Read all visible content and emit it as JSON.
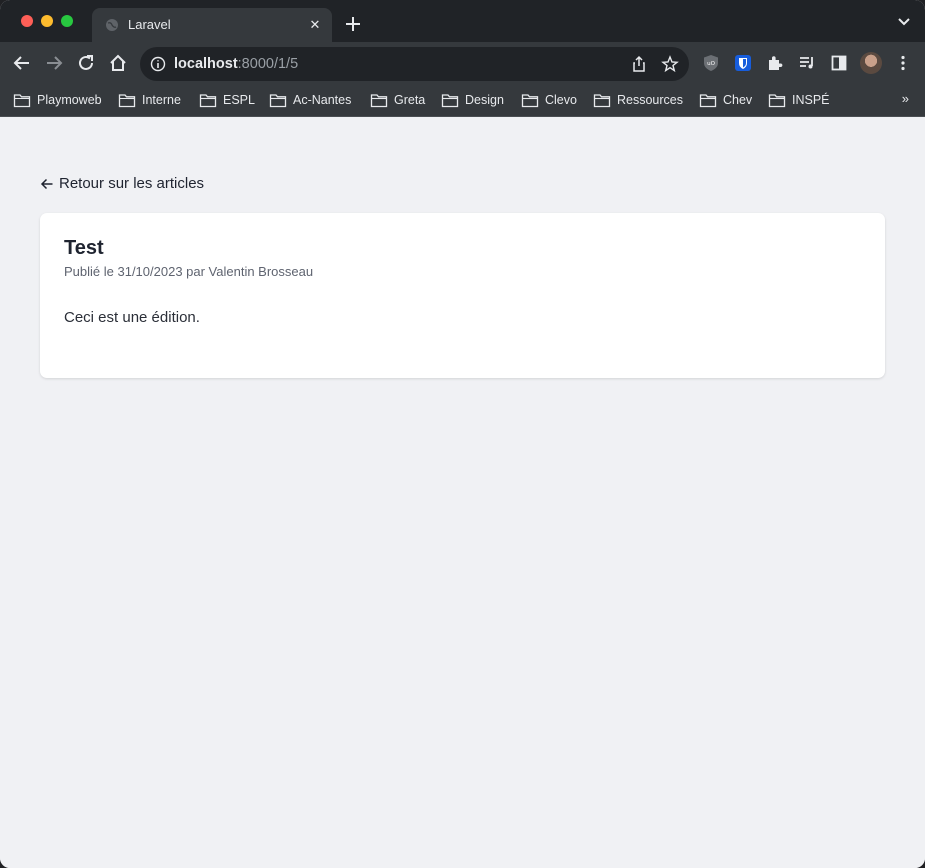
{
  "browser": {
    "tab": {
      "title": "Laravel",
      "close_label": "✕"
    },
    "omnibox": {
      "host": "localhost",
      "path": ":8000/1/5"
    },
    "bookmarks": [
      "Playmoweb",
      "Interne",
      "ESPL",
      "Ac-Nantes",
      "Greta",
      "Design",
      "Clevo",
      "Ressources",
      "Chev",
      "INSPÉ"
    ],
    "bookmarks_more": "»"
  },
  "page": {
    "back_label": "Retour sur les articles",
    "article": {
      "title": "Test",
      "meta": "Publié le 31/10/2023 par Valentin Brosseau",
      "body": "Ceci est une édition."
    }
  },
  "colors": {
    "page_background": "#f0f1f4",
    "card_background": "#ffffff",
    "chrome_dark": "#202327",
    "chrome_toolbar": "#35393d"
  }
}
